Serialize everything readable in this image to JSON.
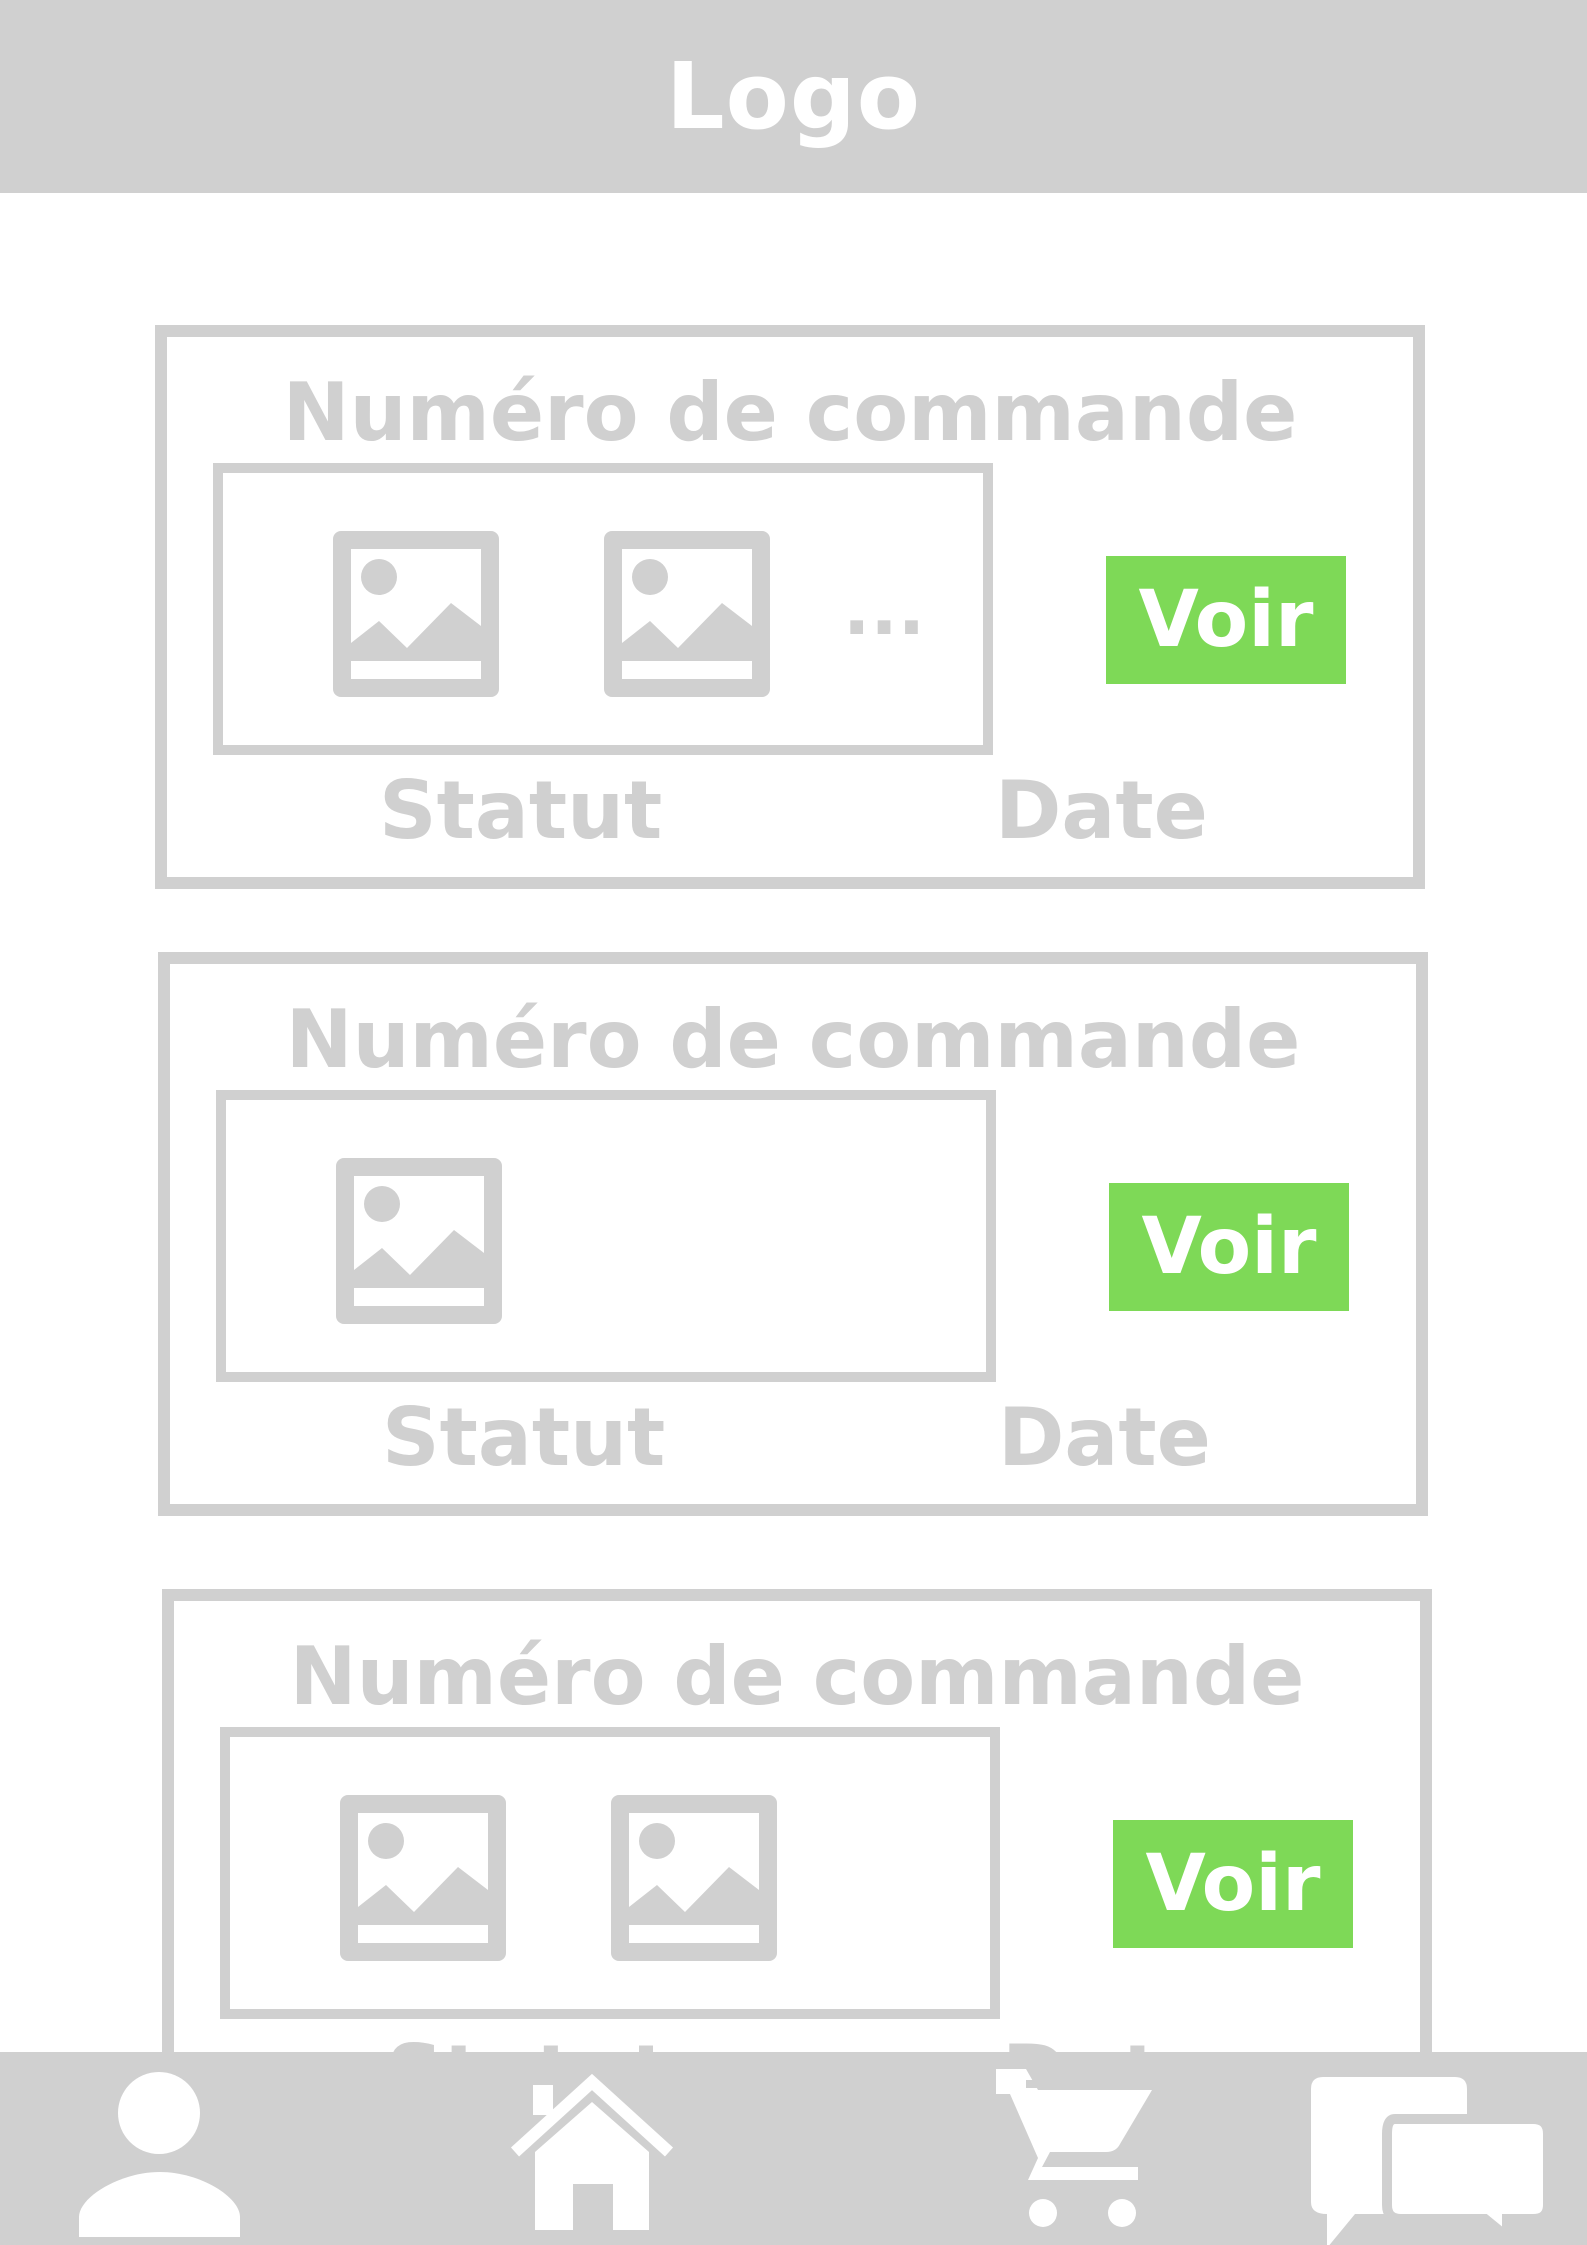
{
  "colors": {
    "gray": "#d0d0d0",
    "green": "#7ed957",
    "white": "#ffffff"
  },
  "header": {
    "logo": "Logo"
  },
  "orders": [
    {
      "title": "Numéro de commande",
      "thumbnails": 2,
      "more_indicator": "...",
      "button_label": "Voir",
      "status_label": "Statut",
      "date_label": "Date"
    },
    {
      "title": "Numéro de commande",
      "thumbnails": 1,
      "more_indicator": "",
      "button_label": "Voir",
      "status_label": "Statut",
      "date_label": "Date"
    },
    {
      "title": "Numéro de commande",
      "thumbnails": 2,
      "more_indicator": "",
      "button_label": "Voir",
      "status_label": "Statut",
      "date_label": "Date"
    }
  ],
  "bottom_nav": {
    "items": [
      {
        "icon": "user-icon"
      },
      {
        "icon": "home-icon"
      },
      {
        "icon": "cart-icon"
      },
      {
        "icon": "chat-icon"
      }
    ]
  }
}
